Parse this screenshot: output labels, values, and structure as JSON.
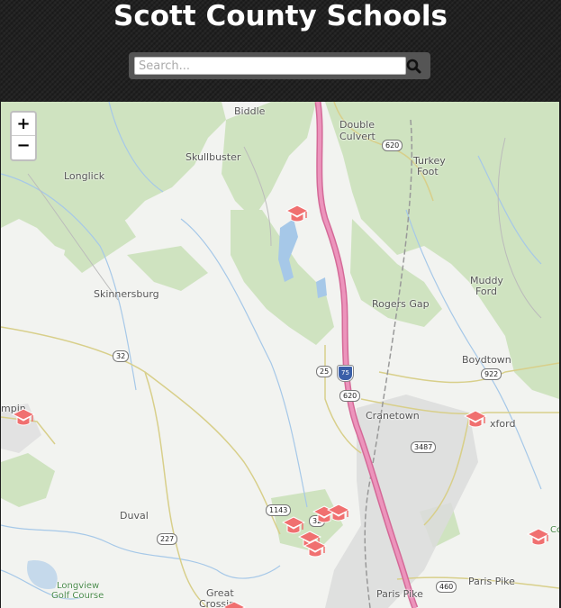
{
  "header": {
    "title": "Scott County Schools",
    "search_placeholder": "Search...",
    "search_icon": "search-icon"
  },
  "map": {
    "zoom_in_label": "+",
    "zoom_out_label": "−",
    "places": {
      "biddle": "Biddle",
      "double": "Double",
      "culvert": "Culvert",
      "skullbuster": "Skullbuster",
      "longlick": "Longlick",
      "turkey": "Turkey",
      "foot": "Foot",
      "skinnersburg": "Skinnersburg",
      "muddy": "Muddy",
      "ford": "Ford",
      "rogers_gap": "Rogers Gap",
      "boydtown": "Boydtown",
      "cranetown": "Cranetown",
      "oxford_partial": "xford",
      "sampson_partial": "mpin",
      "duval": "Duval",
      "great": "Great",
      "crossing_partial": "Crossin",
      "longview": "Longview",
      "golf_course": "Golf Course",
      "paris_pike_1": "Paris Pike",
      "paris_pike_2": "Paris Pike",
      "right_edge_partial": "Co"
    },
    "route_shields": {
      "r620a": "620",
      "r620b": "620",
      "r32": "32",
      "r25": "25",
      "i75": "75",
      "r922": "922",
      "r3487": "3487",
      "r1143": "1143",
      "r32b": "32",
      "r227": "227",
      "r460": "460"
    },
    "school_marker_icon": "graduation-cap-icon",
    "colors": {
      "forest": "#cfe3c0",
      "interstate": "#e07aa5",
      "water": "#a6c8e8",
      "urban": "#dcdcdc",
      "marker": "#f07070"
    }
  }
}
